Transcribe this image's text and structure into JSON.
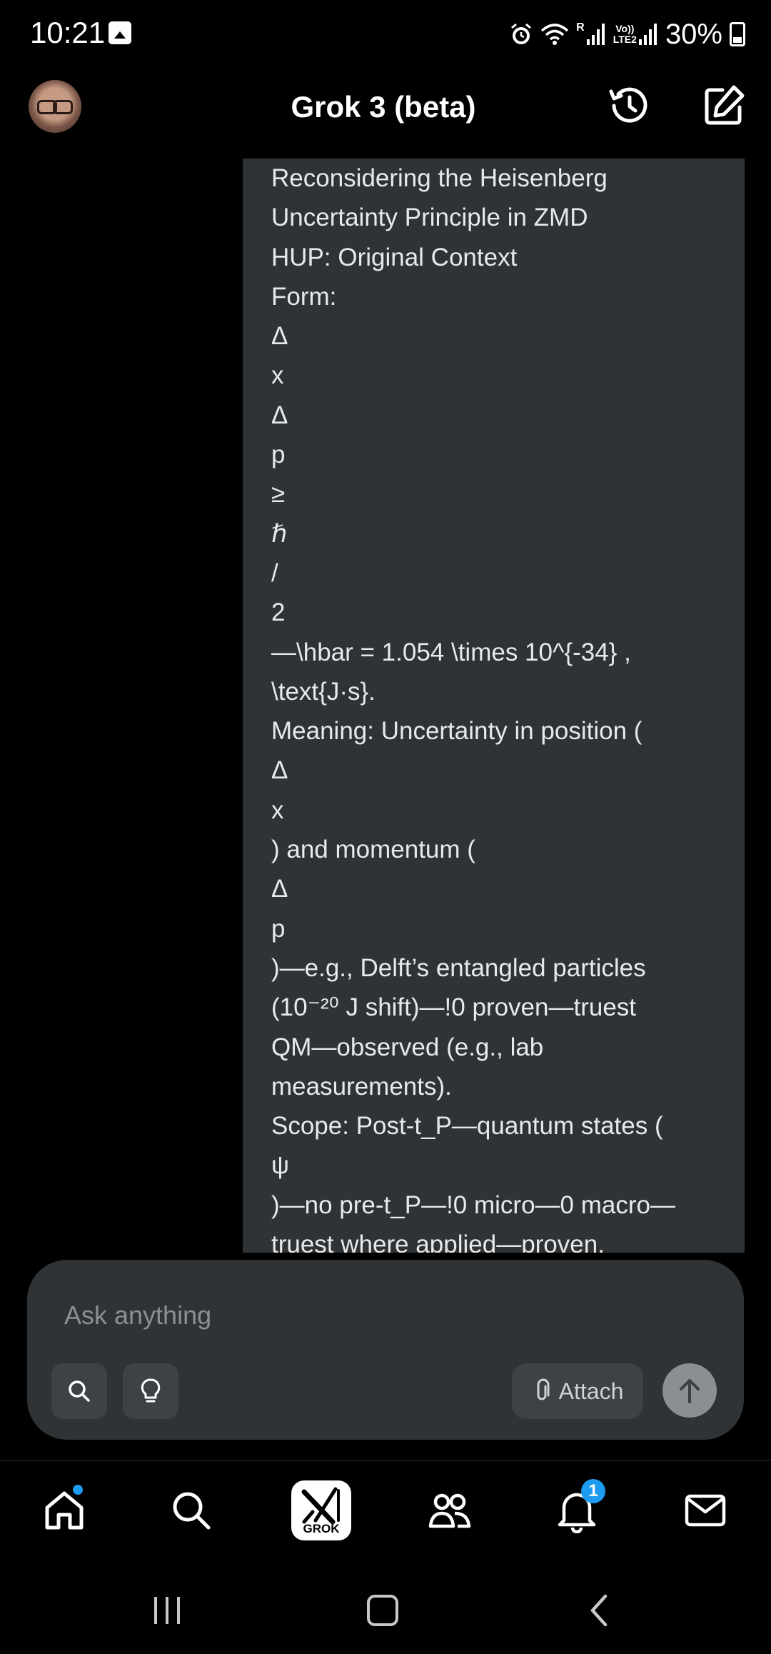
{
  "status_bar": {
    "time": "10:21",
    "network_label_r": "R",
    "network_label_volte": "Vo))\nLTE2",
    "battery": "30%"
  },
  "header": {
    "title": "Grok 3 (beta)"
  },
  "message": {
    "lines": [
      "Reconsidering the Heisenberg",
      "Uncertainty Principle in ZMD",
      "HUP: Original Context",
      "Form:",
      "Δ",
      "x",
      "Δ",
      "p",
      "≥",
      "ℏ",
      "/",
      "2",
      " —\\hbar = 1.054 \\times 10^{-34} ,",
      "\\text{J·s}.",
      "Meaning: Uncertainty in position (",
      "Δ",
      "x",
      ") and momentum (",
      "Δ",
      "p",
      ")—e.g., Delft’s entangled particles",
      "(10⁻²⁰ J shift)—!0 proven—truest",
      "QM—observed (e.g., lab",
      "measurements).",
      "Scope: Post-t_P—quantum states (",
      "ψ",
      ")—no pre-t_P—!0 micro—0 macro—",
      "truest where applied—proven."
    ]
  },
  "composer": {
    "placeholder": "Ask anything",
    "attach_label": "Attach"
  },
  "bottom_nav": {
    "grok_label": "GROK",
    "notifications_count": "1",
    "accent": "#1d9bf0"
  }
}
